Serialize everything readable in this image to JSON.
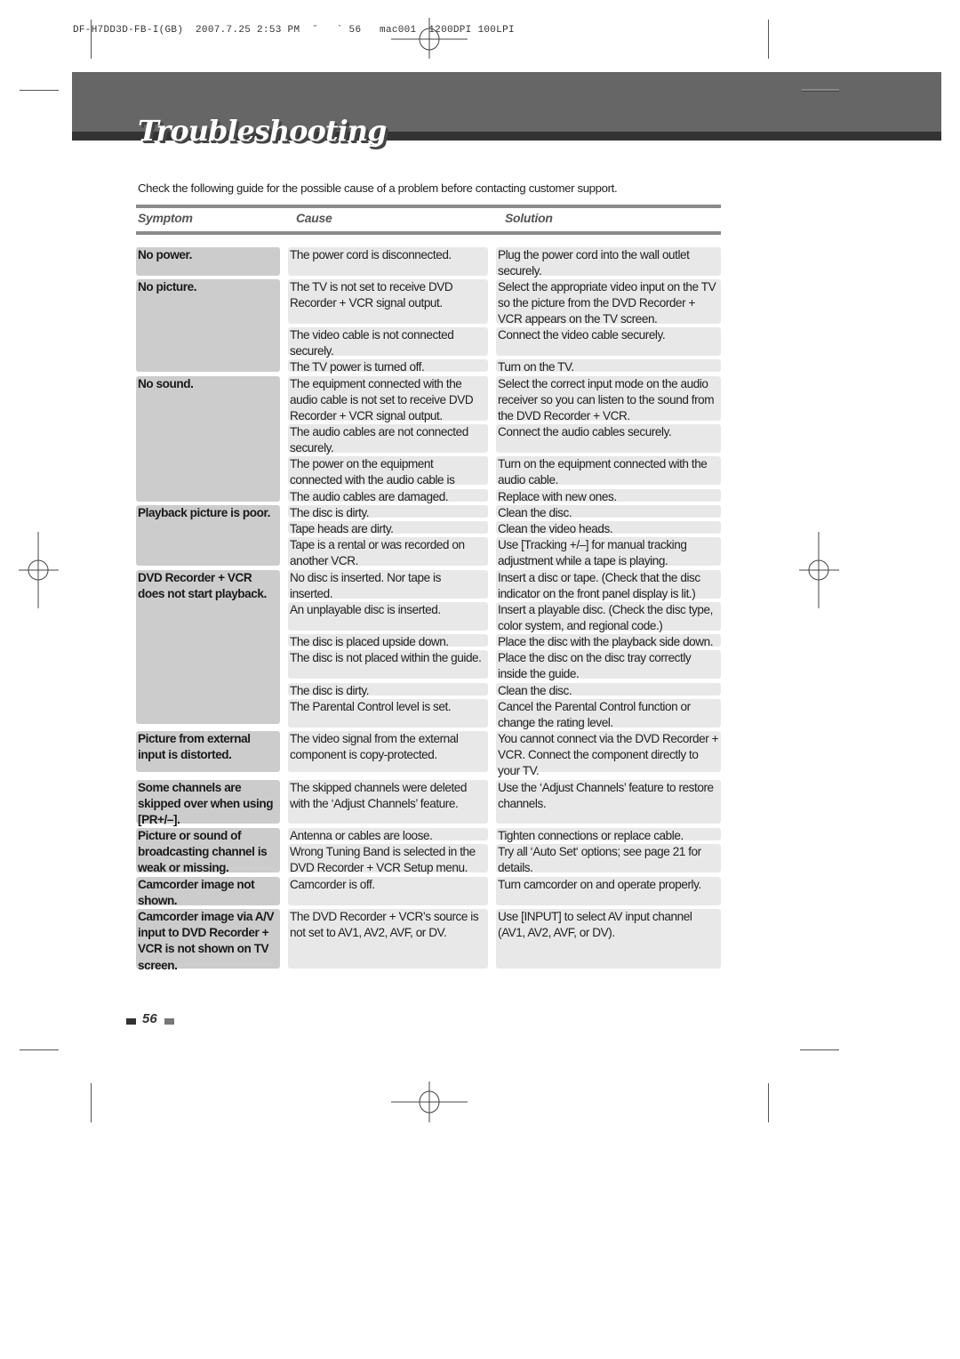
{
  "print_info": "DF-H7DD3D-FB-I(GB)  2007.7.25 2:53 PM  ˘   ` 56   mac001  1200DPI 100LPI",
  "title": "Troubleshooting",
  "intro": "Check the following guide for the possible cause of a problem before contacting customer support.",
  "headers": {
    "symptom": "Symptom",
    "cause": "Cause",
    "solution": "Solution"
  },
  "groups": [
    {
      "symptom": "No power.",
      "items": [
        {
          "cause": "The power cord is disconnected.",
          "solution": "Plug the power cord into the wall outlet securely."
        }
      ]
    },
    {
      "symptom": "No picture.",
      "items": [
        {
          "cause": "The TV is not set to receive DVD Recorder + VCR signal output.",
          "solution": "Select the appropriate video input on the TV so the picture from the DVD Recorder + VCR appears on the TV screen."
        },
        {
          "cause": "The video cable is not connected securely.",
          "solution": "Connect the video cable securely."
        },
        {
          "cause": "The TV power is turned off.",
          "solution": "Turn on the TV."
        }
      ]
    },
    {
      "symptom": "No sound.",
      "items": [
        {
          "cause": "The equipment connected with the audio cable is not set to receive DVD Recorder + VCR signal output.",
          "solution": "Select the correct input mode on the audio receiver so you can listen to the sound from the DVD Recorder + VCR."
        },
        {
          "cause": "The audio cables are not connected securely.",
          "solution": "Connect the audio cables securely."
        },
        {
          "cause": "The power on the equipment connected with the audio cable is turned off.",
          "solution": "Turn on the equipment connected with the audio cable."
        },
        {
          "cause": "The audio cables are damaged.",
          "solution": "Replace with new ones."
        }
      ]
    },
    {
      "symptom": "Playback picture is poor.",
      "items": [
        {
          "cause": "The disc is dirty.",
          "solution": "Clean the disc."
        },
        {
          "cause": "Tape heads are dirty.",
          "solution": "Clean the video heads."
        },
        {
          "cause": "Tape is a rental or was recorded on another VCR.",
          "solution": "Use [Tracking +/–] for manual tracking adjustment while a tape is playing."
        }
      ]
    },
    {
      "symptom": "DVD Recorder + VCR does not start playback.",
      "items": [
        {
          "cause": "No disc is inserted. Nor tape is inserted.",
          "solution": "Insert a disc or tape. (Check that the disc indicator on the front panel display is lit.)"
        },
        {
          "cause": "An unplayable disc is inserted.",
          "solution": "Insert a playable disc. (Check the disc type, color system, and regional code.)"
        },
        {
          "cause": "The disc is placed upside down.",
          "solution": "Place the disc with the playback side down."
        },
        {
          "cause": "The disc is not placed within the guide.",
          "solution": "Place the disc on the disc tray correctly inside the guide."
        },
        {
          "cause": "The disc is dirty.",
          "solution": "Clean the disc."
        },
        {
          "cause": "The Parental Control level is set.",
          "solution": "Cancel the Parental Control function or change the rating level."
        }
      ]
    },
    {
      "symptom": "Picture from external input is distorted.",
      "items": [
        {
          "cause": "The video signal from the external component is copy-protected.",
          "solution": "You cannot connect via the DVD Recorder + VCR. Connect the component directly to your TV."
        }
      ]
    },
    {
      "symptom": "Some channels are skipped over when using [PR+/–].",
      "items": [
        {
          "cause": "The skipped channels were deleted with the ‘Adjust Channels’ feature.",
          "solution": "Use the ‘Adjust Channels’ feature to restore channels."
        }
      ]
    },
    {
      "symptom": "Picture or sound of broadcasting channel is weak or missing.",
      "items": [
        {
          "cause": "Antenna or cables are loose.",
          "solution": "Tighten connections or replace cable."
        },
        {
          "cause": "Wrong Tuning Band is selected in the DVD Recorder + VCR Setup menu.",
          "solution": "Try all ‘Auto Set‘ options; see page 21 for details."
        }
      ]
    },
    {
      "symptom": "Camcorder image not shown.",
      "items": [
        {
          "cause": "Camcorder is off.",
          "solution": "Turn camcorder on and operate properly."
        }
      ]
    },
    {
      "symptom": "Camcorder image via A/V input to DVD Recorder + VCR is not shown on TV screen.",
      "items": [
        {
          "cause": "The DVD Recorder + VCR’s source is not set to AV1, AV2, AVF, or DV.",
          "solution": "Use [INPUT] to select AV input channel (AV1, AV2, AVF, or DV)."
        }
      ]
    }
  ],
  "page_number": "56"
}
